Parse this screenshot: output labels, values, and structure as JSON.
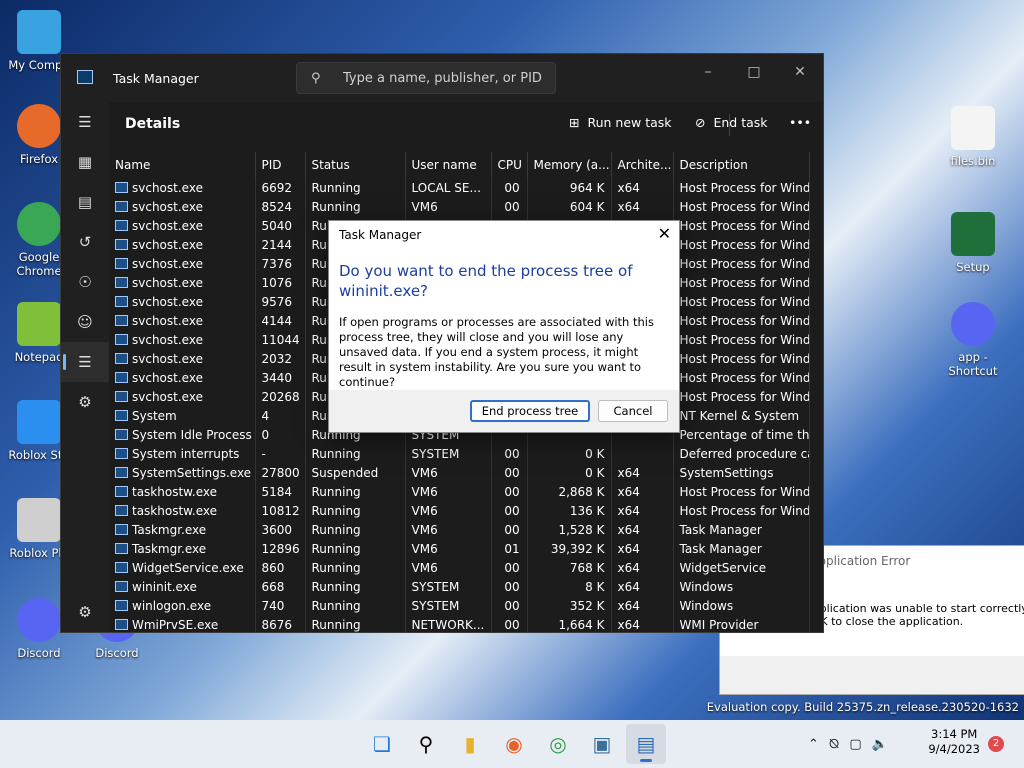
{
  "desktop": {
    "icons_left": [
      {
        "label": "My Compu",
        "icon": "computer-icon"
      },
      {
        "label": "Firefox",
        "icon": "firefox-icon"
      },
      {
        "label": "Google Chrome",
        "icon": "chrome-icon"
      },
      {
        "label": "Notepad",
        "icon": "notepad-icon"
      },
      {
        "label": "Roblox Stu",
        "icon": "roblox-studio-icon"
      },
      {
        "label": "Roblox Pla",
        "icon": "roblox-player-icon"
      },
      {
        "label": "Discord",
        "icon": "discord-icon"
      }
    ],
    "icons_right": [
      {
        "label": "files.bin",
        "icon": "file-icon"
      },
      {
        "label": "Setup",
        "icon": "setup-icon"
      },
      {
        "label": "app - Shortcut",
        "icon": "discord-icon"
      }
    ],
    "icon_discord2": "Discord",
    "watermark_line2": "Evaluation copy. Build 25375.zn_release.230520-1632"
  },
  "taskmgr": {
    "title": "Task Manager",
    "search_placeholder": "Type a name, publisher, or PID...",
    "page_heading": "Details",
    "run_new_task": "Run new task",
    "end_task": "End task",
    "more": "•••",
    "columns": [
      "Name",
      "PID",
      "Status",
      "User name",
      "CPU",
      "Memory (a...",
      "Archite...",
      "Description"
    ],
    "rows": [
      [
        "svchost.exe",
        "6692",
        "Running",
        "LOCAL SE...",
        "00",
        "964 K",
        "x64",
        "Host Process for Wind..."
      ],
      [
        "svchost.exe",
        "8524",
        "Running",
        "VM6",
        "00",
        "604 K",
        "x64",
        "Host Process for Wind..."
      ],
      [
        "svchost.exe",
        "5040",
        "Running",
        "SYSTEM",
        "00",
        "524 K",
        "x64",
        "Host Process for Wind..."
      ],
      [
        "svchost.exe",
        "2144",
        "Running",
        "",
        "",
        "",
        "",
        "Host Process for Wind..."
      ],
      [
        "svchost.exe",
        "7376",
        "Running",
        "",
        "",
        "",
        "",
        "Host Process for Wind..."
      ],
      [
        "svchost.exe",
        "1076",
        "Running",
        "",
        "",
        "",
        "",
        "Host Process for Wind..."
      ],
      [
        "svchost.exe",
        "9576",
        "Running",
        "",
        "",
        "",
        "",
        "Host Process for Wind..."
      ],
      [
        "svchost.exe",
        "4144",
        "Running",
        "",
        "",
        "",
        "",
        "Host Process for Wind..."
      ],
      [
        "svchost.exe",
        "11044",
        "Running",
        "",
        "",
        "",
        "",
        "Host Process for Wind..."
      ],
      [
        "svchost.exe",
        "2032",
        "Running",
        "",
        "",
        "",
        "",
        "Host Process for Wind..."
      ],
      [
        "svchost.exe",
        "3440",
        "Running",
        "",
        "",
        "",
        "",
        "Host Process for Wind..."
      ],
      [
        "svchost.exe",
        "20268",
        "Running",
        "",
        "",
        "",
        "",
        "Host Process for Wind..."
      ],
      [
        "System",
        "4",
        "Running",
        "",
        "",
        "",
        "",
        "NT Kernel & System"
      ],
      [
        "System Idle Process",
        "0",
        "Running",
        "SYSTEM",
        "",
        "",
        "",
        "Percentage of time th..."
      ],
      [
        "System interrupts",
        "-",
        "Running",
        "SYSTEM",
        "00",
        "0 K",
        "",
        "Deferred procedure ca..."
      ],
      [
        "SystemSettings.exe",
        "27800",
        "Suspended",
        "VM6",
        "00",
        "0 K",
        "x64",
        "SystemSettings"
      ],
      [
        "taskhostw.exe",
        "5184",
        "Running",
        "VM6",
        "00",
        "2,868 K",
        "x64",
        "Host Process for Wind..."
      ],
      [
        "taskhostw.exe",
        "10812",
        "Running",
        "VM6",
        "00",
        "136 K",
        "x64",
        "Host Process for Wind..."
      ],
      [
        "Taskmgr.exe",
        "3600",
        "Running",
        "VM6",
        "00",
        "1,528 K",
        "x64",
        "Task Manager"
      ],
      [
        "Taskmgr.exe",
        "12896",
        "Running",
        "VM6",
        "01",
        "39,392 K",
        "x64",
        "Task Manager"
      ],
      [
        "WidgetService.exe",
        "860",
        "Running",
        "VM6",
        "00",
        "768 K",
        "x64",
        "WidgetService"
      ],
      [
        "wininit.exe",
        "668",
        "Running",
        "SYSTEM",
        "00",
        "8 K",
        "x64",
        "Windows"
      ],
      [
        "winlogon.exe",
        "740",
        "Running",
        "SYSTEM",
        "00",
        "352 K",
        "x64",
        "Windows"
      ],
      [
        "WmiPrvSE.exe",
        "8676",
        "Running",
        "NETWORK...",
        "00",
        "1,664 K",
        "x64",
        "WMI Provider"
      ]
    ]
  },
  "dialog": {
    "title": "Task Manager",
    "heading": "Do you want to end the process tree of wininit.exe?",
    "message": "If open programs or processes are associated with this process tree, they will close and you will lose any unsaved data. If you end a system process, it might result in system instability. Are you sure you want to continue?",
    "confirm": "End process tree",
    "cancel": "Cancel"
  },
  "error": {
    "title": "Discord.exe - Application Error",
    "line1": "The application was unable to start correctly (0x",
    "line2": "Click OK to close the application."
  },
  "taskbar": {
    "time": "3:14 PM",
    "date": "9/4/2023",
    "notifications": "2"
  }
}
